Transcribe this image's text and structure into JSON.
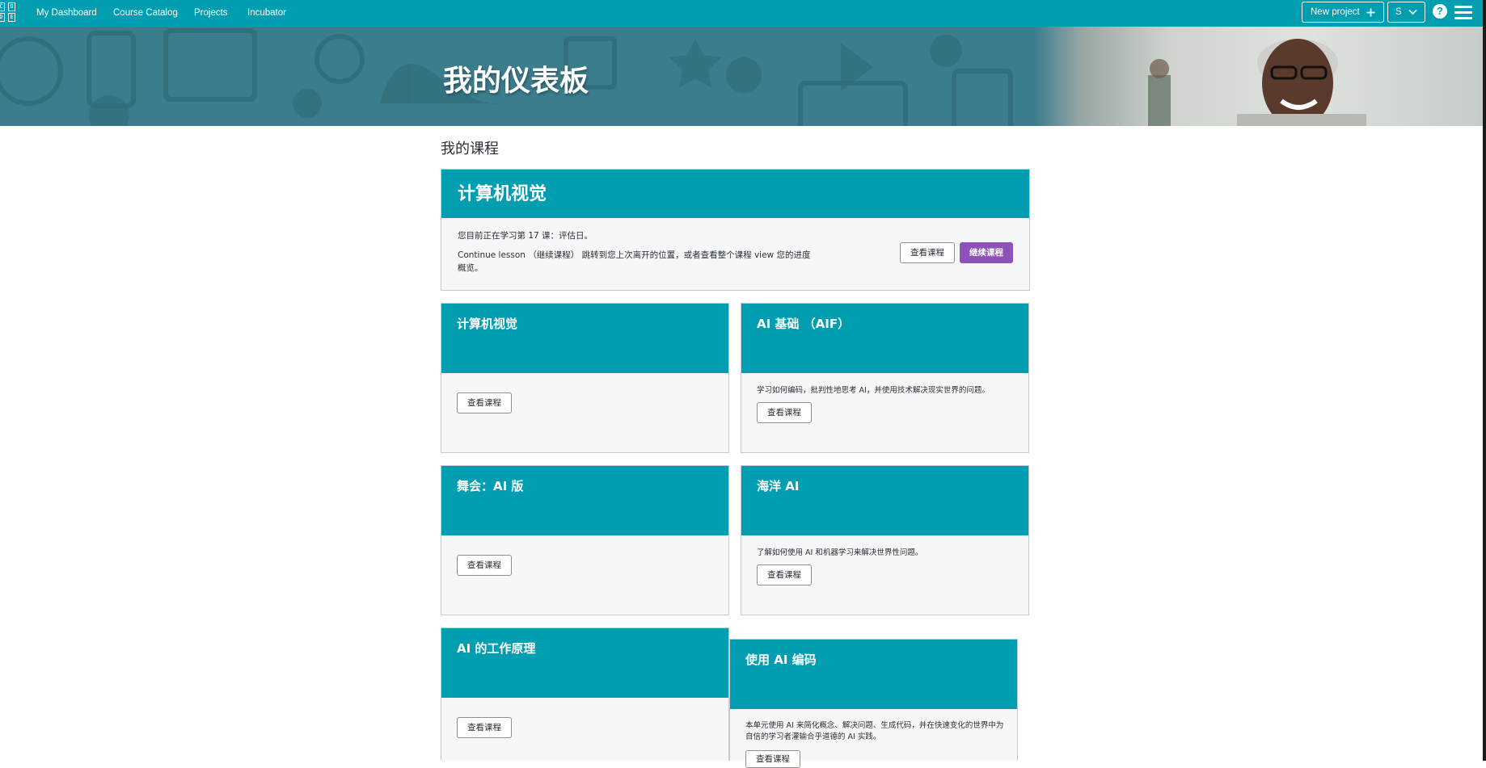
{
  "nav": {
    "logo_letters": [
      "C",
      "O",
      "D",
      "E"
    ],
    "links": [
      {
        "label": "My Dashboard"
      },
      {
        "label": "Course Catalog"
      },
      {
        "label": "Projects"
      },
      {
        "label": "Incubator"
      }
    ],
    "new_project_label": "New project",
    "new_project_icon": "plus-icon",
    "user_initial": "S",
    "help_label": "?",
    "menu_icon": "hamburger-icon"
  },
  "banner": {
    "title": "我的仪表板"
  },
  "my_courses": {
    "section_title": "我的课程",
    "top_course": {
      "title": "计算机视觉",
      "progress_text": "您目前正在学习第 17 课：评估日。",
      "description": "Continue lesson （继续课程） 跳转到您上次离开的位置，或者查看整个课程 view 您的进度概览。",
      "view_button": "查看课程",
      "continue_button": "继续课程"
    },
    "cards": [
      {
        "title": "计算机视觉",
        "description": "",
        "button": "查看课程"
      },
      {
        "title": "AI 基础 （AIF）",
        "description": "学习如何编码，批判性地思考 AI，并使用技术解决现实世界的问题。",
        "button": "查看课程"
      },
      {
        "title": "舞会：AI 版",
        "description": "",
        "button": "查看课程"
      },
      {
        "title": "海洋 AI",
        "description": "了解如何使用 AI 和机器学习来解决世界性问题。",
        "button": "查看课程"
      },
      {
        "title": "AI 的工作原理",
        "description": "",
        "button": "查看课程"
      },
      {
        "title": "使用 AI 编码",
        "description": "本单元使用 AI 来简化概念、解决问题、生成代码，并在快速变化的世界中为自信的学习者灌输合乎道德的 AI 实践。",
        "button": "查看课程"
      }
    ]
  },
  "colors": {
    "brand_teal": "#009eb0",
    "banner_teal": "#3b7d8c",
    "purple_button": "#8c52ba",
    "card_body": "#f6f7f8"
  }
}
